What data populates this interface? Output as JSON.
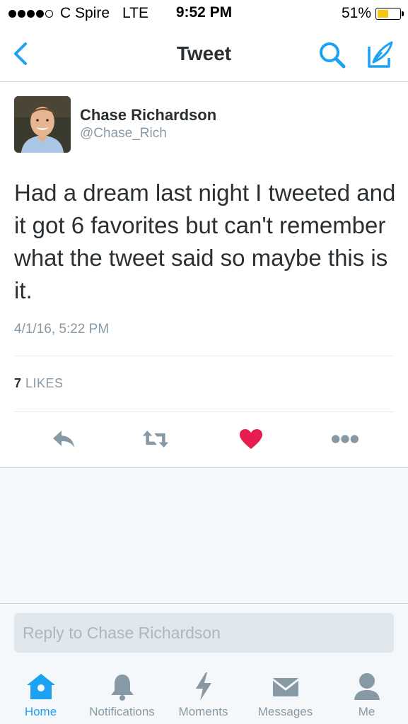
{
  "status_bar": {
    "carrier": "C Spire",
    "network": "LTE",
    "time": "9:52 PM",
    "battery_percent": "51%",
    "battery_level": 0.51,
    "battery_color": "#f5c518"
  },
  "nav": {
    "title": "Tweet",
    "back_icon": "chevron-left-icon",
    "search_icon": "search-icon",
    "compose_icon": "compose-icon",
    "accent": "#1da1f2"
  },
  "tweet": {
    "user_name": "Chase Richardson",
    "user_handle": "@Chase_Rich",
    "text": "Had a dream last night I tweeted and it got 6 favorites but can't remember what the tweet said so maybe this is it.",
    "timestamp": "4/1/16, 5:22 PM",
    "likes_count": "7",
    "likes_label": "LIKES",
    "actions": [
      "reply-icon",
      "retweet-icon",
      "heart-icon",
      "more-icon"
    ],
    "heart_color": "#e81c4f"
  },
  "reply": {
    "placeholder": "Reply to Chase Richardson"
  },
  "tabs": [
    {
      "label": "Home",
      "icon": "home-icon",
      "active": true
    },
    {
      "label": "Notifications",
      "icon": "bell-icon",
      "active": false
    },
    {
      "label": "Moments",
      "icon": "lightning-icon",
      "active": false
    },
    {
      "label": "Messages",
      "icon": "envelope-icon",
      "active": false
    },
    {
      "label": "Me",
      "icon": "person-icon",
      "active": false
    }
  ]
}
